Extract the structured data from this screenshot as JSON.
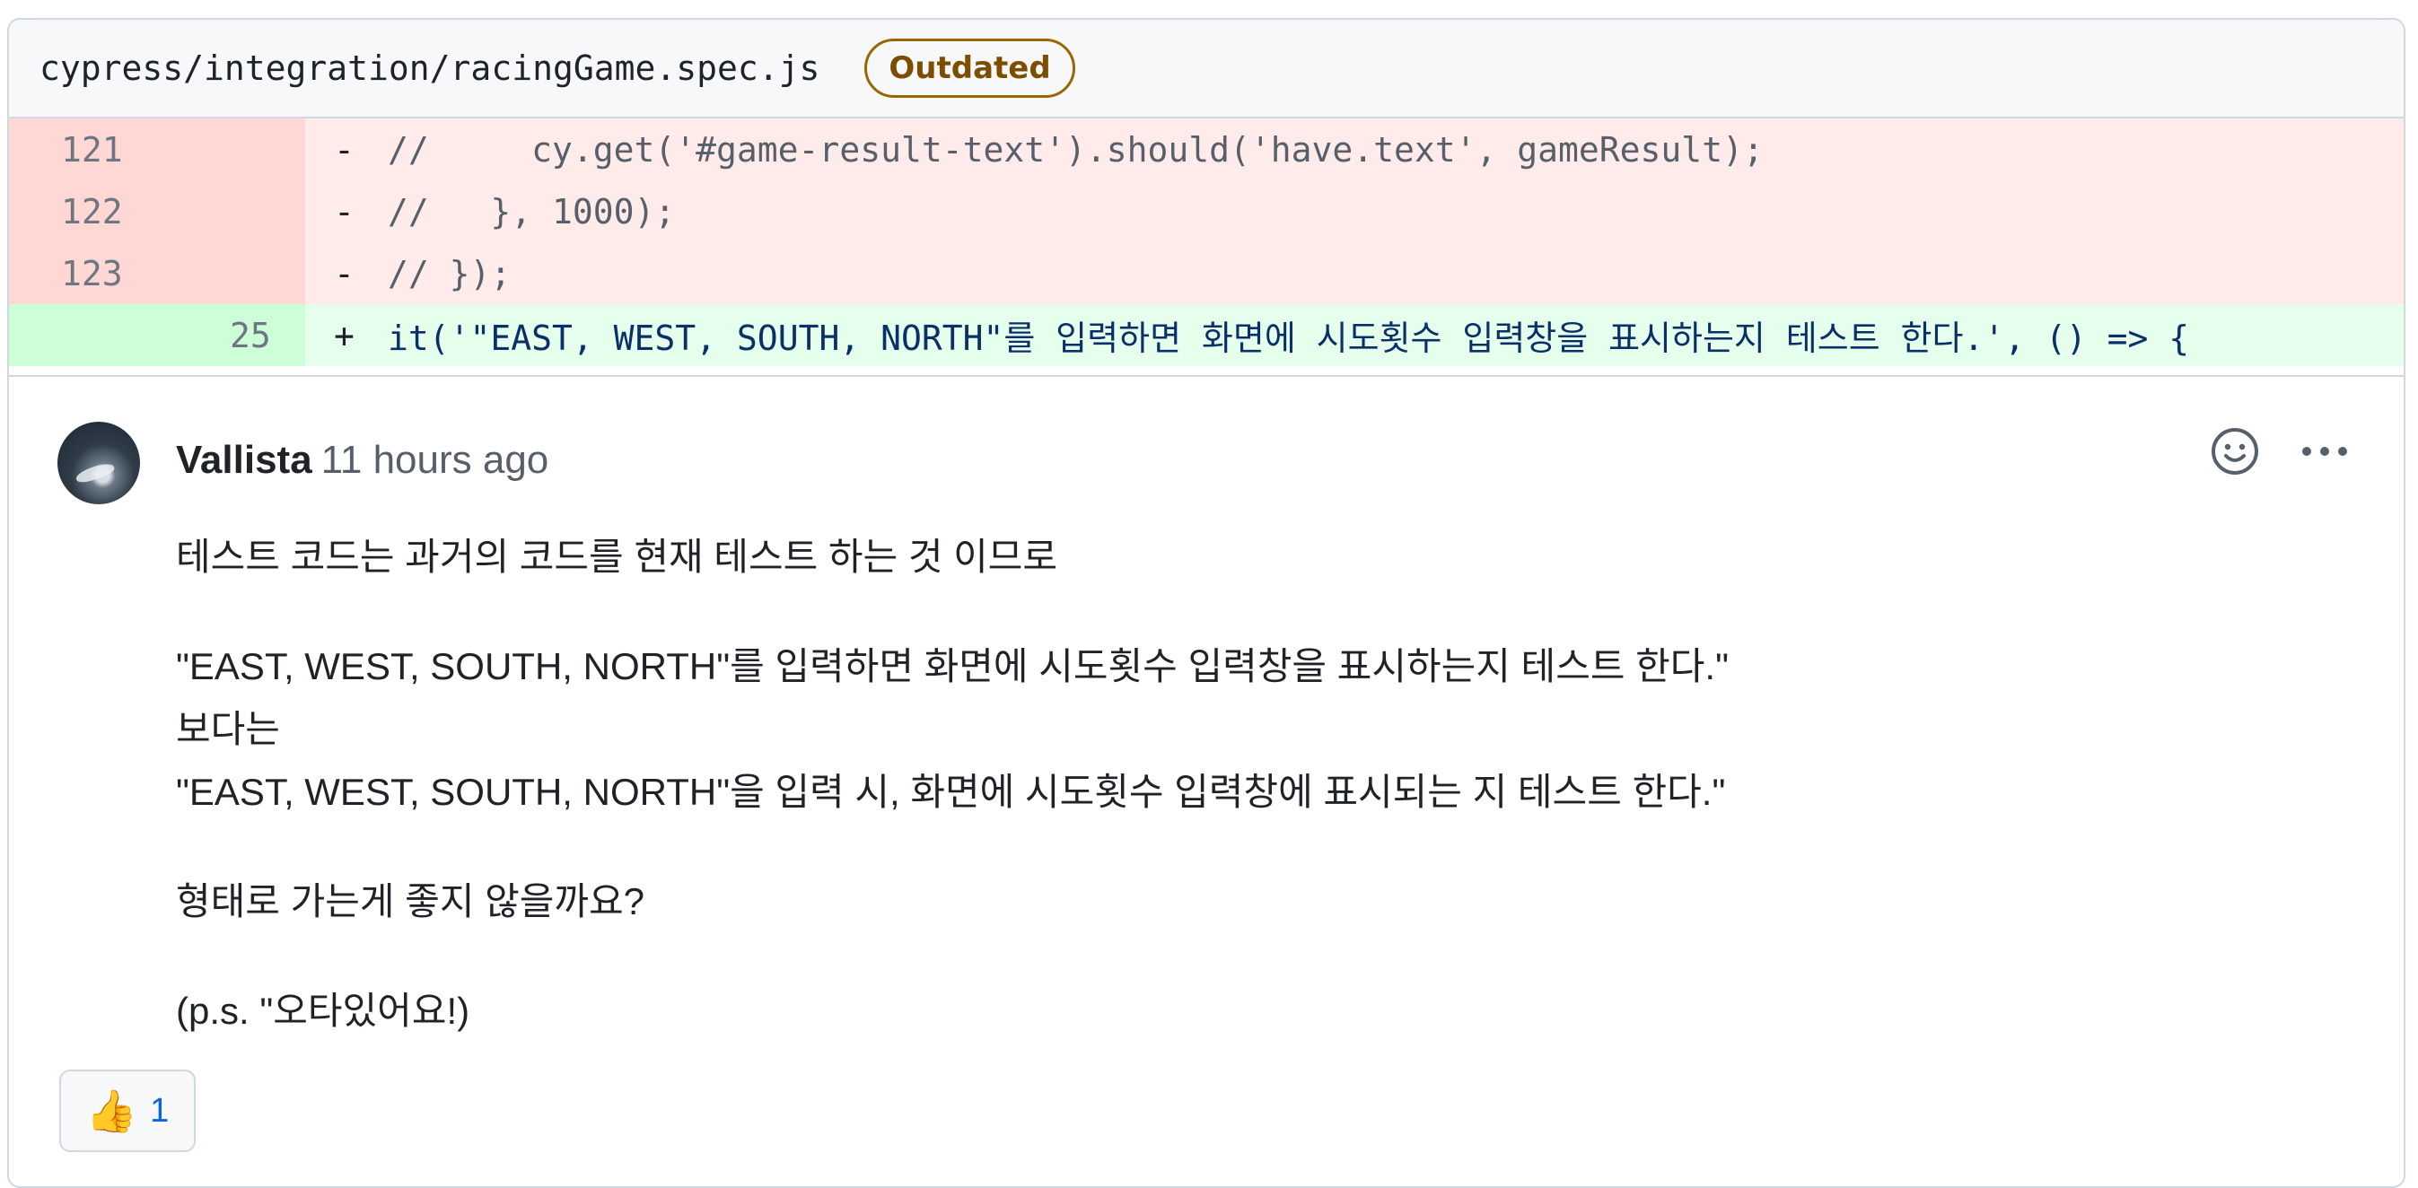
{
  "file": {
    "path": "cypress/integration/racingGame.spec.js",
    "badge": "Outdated"
  },
  "diff": {
    "lines": [
      {
        "type": "del",
        "old": "121",
        "new": "",
        "marker": "-",
        "code": "//     cy.get('#game-result-text').should('have.text', gameResult);"
      },
      {
        "type": "del",
        "old": "122",
        "new": "",
        "marker": "-",
        "code": "//   }, 1000);"
      },
      {
        "type": "del",
        "old": "123",
        "new": "",
        "marker": "-",
        "code": "// });"
      },
      {
        "type": "add",
        "old": "",
        "new": "25",
        "marker": "+",
        "code_prefix": "it(",
        "code_string": "'\"EAST, WEST, SOUTH, NORTH\"를 입력하면 화면에 시도횟수 입력창을 표시하는지 테스트 한다.'",
        "code_suffix": ", () => {"
      }
    ]
  },
  "comment": {
    "author": "Vallista",
    "time": "11 hours ago",
    "paragraphs": [
      "테스트 코드는 과거의 코드를 현재 테스트 하는 것 이므로",
      "\"EAST, WEST, SOUTH, NORTH\"를 입력하면 화면에 시도횟수 입력창을 표시하는지 테스트 한다.\"",
      "보다는",
      "\"EAST, WEST, SOUTH, NORTH\"을 입력 시, 화면에 시도횟수 입력창에 표시되는 지 테스트 한다.\"",
      "형태로 가는게 좋지 않을까요?",
      "(p.s. \"오타있어요!)"
    ],
    "reaction": {
      "emoji": "👍",
      "count": "1"
    }
  },
  "icons": {
    "emoji_button": "smiley-icon",
    "more_button": "kebab-horizontal-icon"
  }
}
